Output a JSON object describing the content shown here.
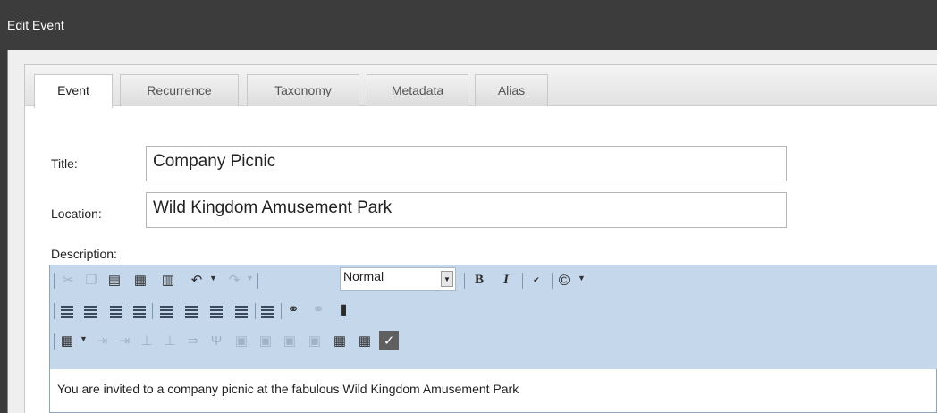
{
  "window": {
    "title": "Edit Event"
  },
  "tabs": [
    {
      "label": "Event",
      "active": true
    },
    {
      "label": "Recurrence",
      "active": false
    },
    {
      "label": "Taxonomy",
      "active": false
    },
    {
      "label": "Metadata",
      "active": false
    },
    {
      "label": "Alias",
      "active": false
    }
  ],
  "form": {
    "title_label": "Title:",
    "title_value": "Company Picnic",
    "location_label": "Location:",
    "location_value": "Wild Kingdom Amusement Park",
    "description_label": "Description:"
  },
  "editor": {
    "format_value": "Normal",
    "bold_label": "B",
    "italic_label": "I",
    "content": "You are invited to a company picnic at the fabulous Wild Kingdom Amusement Park",
    "toolbar_icons": {
      "row1": [
        "cut-icon",
        "copy-icon",
        "paste-icon",
        "paste-text-icon",
        "paste-word-icon",
        "undo-icon",
        "redo-icon",
        "format-select",
        "bold-icon",
        "italic-icon",
        "spellcheck-icon",
        "copyright-icon"
      ],
      "row2": [
        "ordered-list-icon",
        "unordered-list-icon",
        "outdent-icon",
        "indent-icon",
        "align-left-icon",
        "align-center-icon",
        "align-right-icon",
        "justify-icon",
        "definition-list-icon",
        "link-icon",
        "unlink-icon",
        "template-icon"
      ],
      "row3": [
        "table-icon",
        "insert-row-before-icon",
        "insert-row-after-icon",
        "insert-column-before-icon",
        "insert-column-after-icon",
        "delete-row-icon",
        "delete-column-icon",
        "merge-cells-icon",
        "split-cell-icon",
        "cell-props-icon",
        "row-props-icon",
        "table-props-icon",
        "import-table-icon",
        "export-table-icon",
        "toggle-borders-icon"
      ]
    }
  },
  "colors": {
    "toolbar_bg": "#c5d7ea",
    "title_bar_bg": "#3c3c3c"
  }
}
